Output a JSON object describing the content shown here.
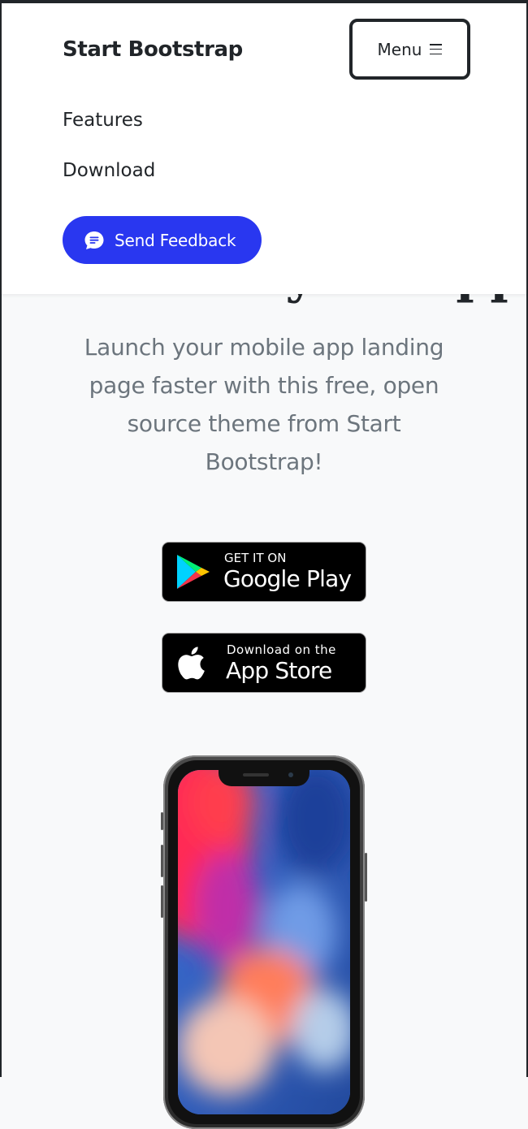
{
  "navbar": {
    "brand": "Start Bootstrap",
    "menu_label": "Menu",
    "links": [
      {
        "label": "Features"
      },
      {
        "label": "Download"
      }
    ],
    "feedback_button": "Send Feedback",
    "feedback_icon": "chat-bubble-icon",
    "accent_color": "#2937f0"
  },
  "hero": {
    "heading": "Showcase your app beautifully.",
    "lead": "Launch your mobile app landing page faster with this free, open source theme from Start Bootstrap!"
  },
  "badges": {
    "google_play": {
      "small": "GET IT ON",
      "big": "Google Play",
      "icon": "google-play-icon"
    },
    "app_store": {
      "small": "Download on the",
      "big": "App Store",
      "icon": "apple-icon"
    }
  }
}
